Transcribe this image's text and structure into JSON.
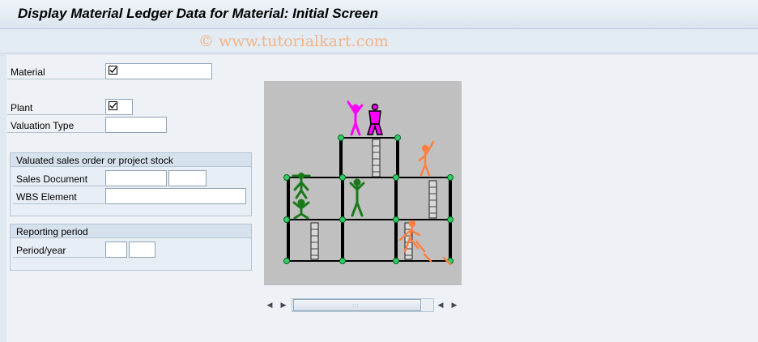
{
  "window": {
    "title": "Display Material Ledger Data for Material: Initial Screen",
    "watermark": "© www.tutorialkart.com"
  },
  "fields": {
    "material": {
      "label": "Material",
      "value": "",
      "required": true
    },
    "plant": {
      "label": "Plant",
      "value": "",
      "required": true
    },
    "valuation_type": {
      "label": "Valuation Type",
      "value": ""
    }
  },
  "groups": {
    "sales_order": {
      "title": "Valuated sales order or project stock",
      "sales_document": {
        "label": "Sales Document",
        "value": "",
        "item": ""
      },
      "wbs_element": {
        "label": "WBS Element",
        "value": ""
      }
    },
    "reporting_period": {
      "title": "Reporting period",
      "period_year": {
        "label": "Period/year",
        "period": "",
        "year": ""
      }
    }
  },
  "picture": {
    "icon": "construction-game-graphic"
  },
  "scrollbar": {
    "grip": ":::"
  },
  "colors": {
    "accent": "#d5e1ec",
    "magenta": "#ff00ff",
    "green": "#1a7a1a",
    "orange": "#ff8040"
  }
}
